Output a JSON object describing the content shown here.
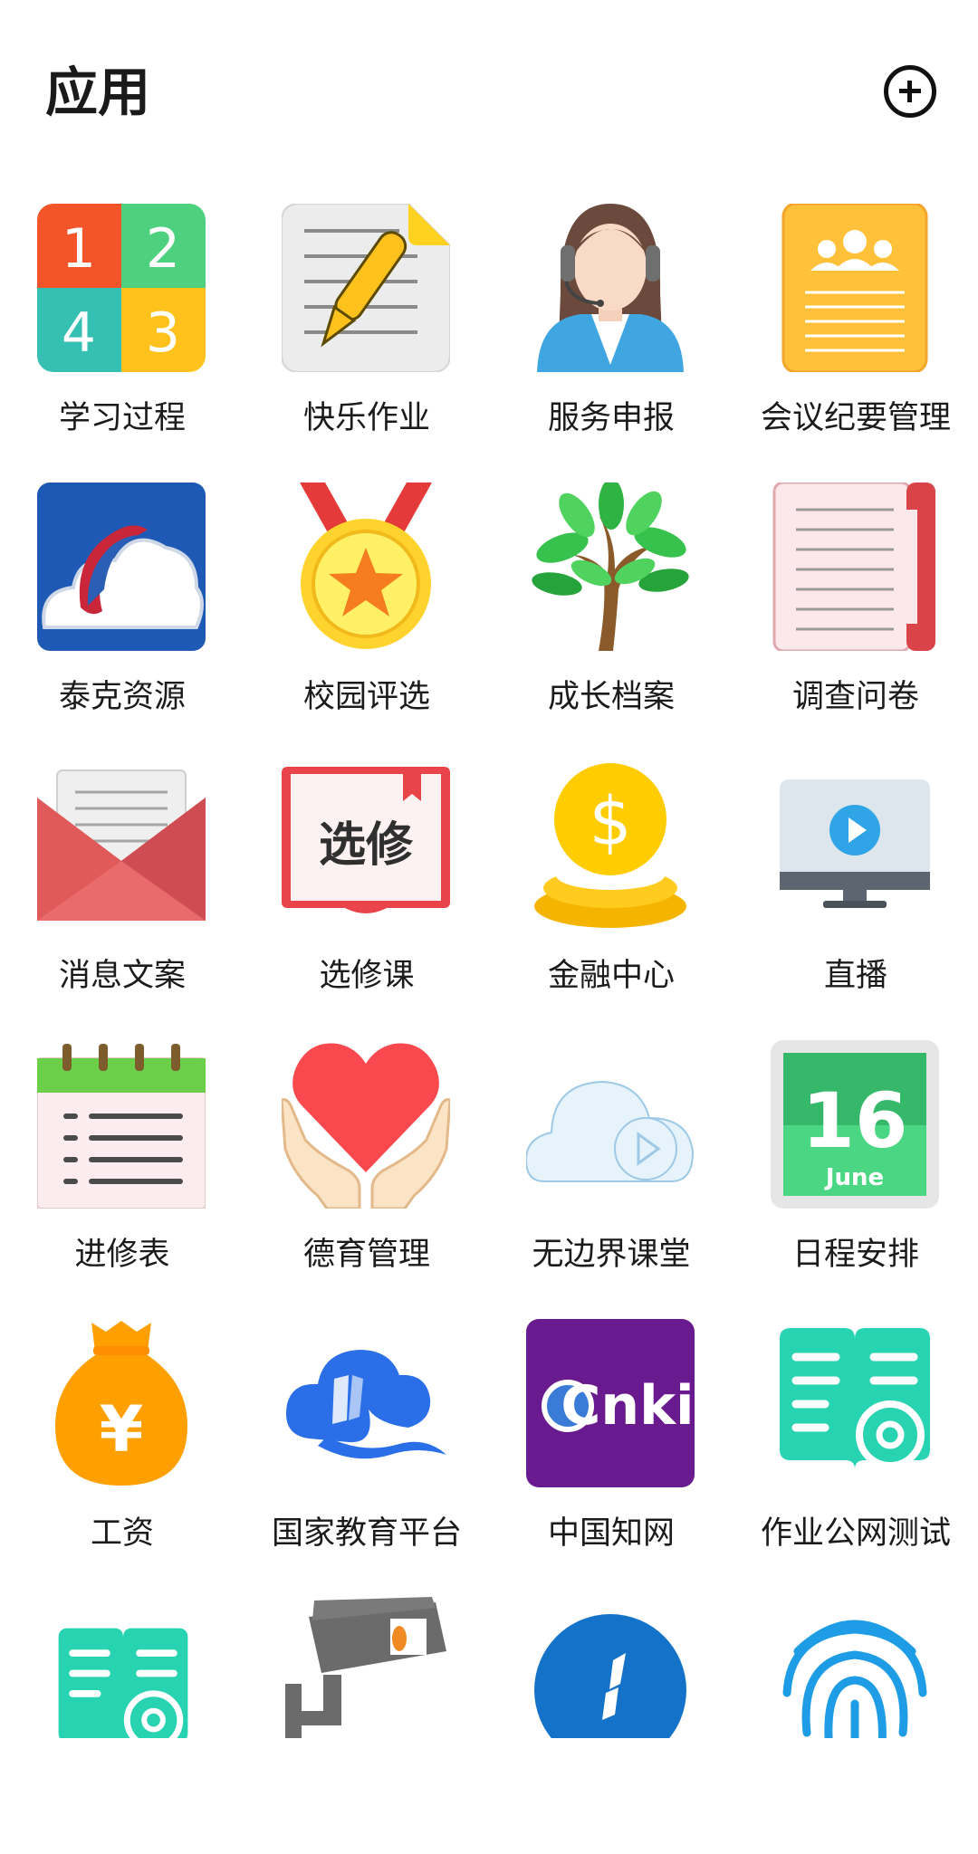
{
  "header": {
    "title": "应用",
    "add_icon": "plus-circle-icon"
  },
  "apps": [
    {
      "label": "学习过程",
      "icon": "numbers-grid-icon"
    },
    {
      "label": "快乐作业",
      "icon": "pen-document-icon"
    },
    {
      "label": "服务申报",
      "icon": "customer-service-icon"
    },
    {
      "label": "会议纪要管理",
      "icon": "meeting-notes-icon"
    },
    {
      "label": "泰克资源",
      "icon": "dolphin-cloud-icon"
    },
    {
      "label": "校园评选",
      "icon": "medal-icon"
    },
    {
      "label": "成长档案",
      "icon": "tree-icon"
    },
    {
      "label": "调查问卷",
      "icon": "scroll-icon"
    },
    {
      "label": "消息文案",
      "icon": "envelope-icon"
    },
    {
      "label": "选修课",
      "icon": "book-icon",
      "icon_text": "选修"
    },
    {
      "label": "金融中心",
      "icon": "coins-icon",
      "icon_text": "$"
    },
    {
      "label": "直播",
      "icon": "monitor-play-icon"
    },
    {
      "label": "进修表",
      "icon": "calendar-list-icon"
    },
    {
      "label": "德育管理",
      "icon": "heart-hands-icon"
    },
    {
      "label": "无边界课堂",
      "icon": "cloud-play-icon"
    },
    {
      "label": "日程安排",
      "icon": "date-calendar-icon",
      "icon_text": "16",
      "icon_subtext": "June"
    },
    {
      "label": "工资",
      "icon": "money-bag-icon",
      "icon_text": "¥"
    },
    {
      "label": "国家教育平台",
      "icon": "education-cloud-icon"
    },
    {
      "label": "中国知网",
      "icon": "cnki-icon",
      "icon_text": "Cnki"
    },
    {
      "label": "作业公网测试",
      "icon": "book-gear-icon"
    },
    {
      "label": "",
      "icon": "book-gear-icon"
    },
    {
      "label": "",
      "icon": "camera-icon"
    },
    {
      "label": "",
      "icon": "blue-circle-icon"
    },
    {
      "label": "",
      "icon": "fingerprint-icon"
    }
  ]
}
